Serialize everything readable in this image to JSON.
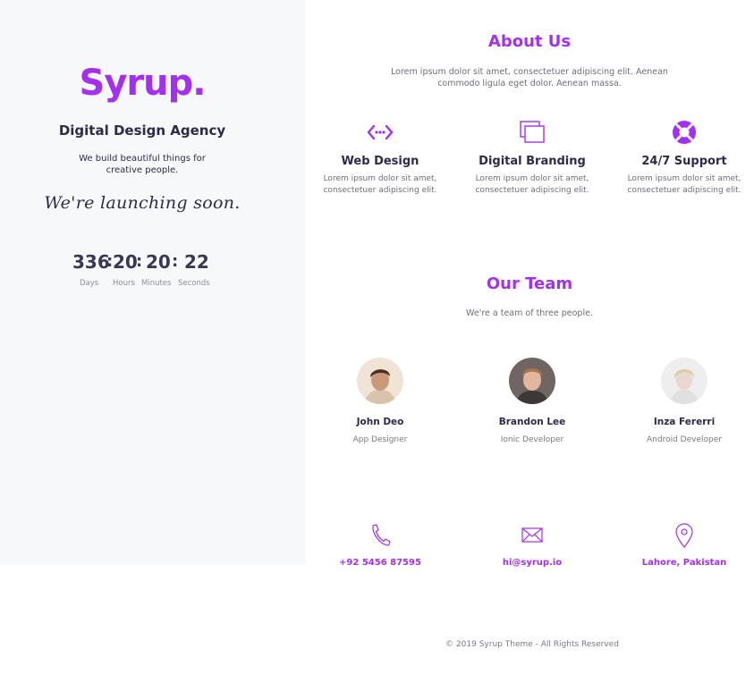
{
  "brand": {
    "logo": "Syrup.",
    "agency": "Digital Design Agency",
    "tagline_line1": "We build beautiful things for",
    "tagline_line2": "creative people.",
    "launching": "We're launching soon."
  },
  "countdown": {
    "days": "336",
    "hours": "20",
    "minutes": "20",
    "seconds": "22",
    "sep": ":",
    "labels": {
      "days": "Days",
      "hours": "Hours",
      "minutes": "Minutes",
      "seconds": "Seconds"
    }
  },
  "about": {
    "title": "About Us",
    "text": "Lorem ipsum dolor sit amet, consectetuer adipiscing elit. Aenean commodo ligula eget dolor. Aenean massa."
  },
  "services": [
    {
      "title": "Web Design",
      "line1": "Lorem ipsum dolor sit amet,",
      "line2": "consectetuer adipiscing elit.",
      "icon": "code-arrows-icon"
    },
    {
      "title": "Digital Branding",
      "line1": "Lorem ipsum dolor sit amet,",
      "line2": "consectetuer adipiscing elit.",
      "icon": "layers-icon"
    },
    {
      "title": "24/7 Support",
      "line1": "Lorem ipsum dolor sit amet,",
      "line2": "consectetuer adipiscing elit.",
      "icon": "lifebuoy-icon"
    }
  ],
  "team": {
    "title": "Our Team",
    "subtitle": "We're a team of three people.",
    "members": [
      {
        "name": "John Deo",
        "role": "App Designer"
      },
      {
        "name": "Brandon Lee",
        "role": "Ionic Developer"
      },
      {
        "name": "Inza Fererri",
        "role": "Android Developer"
      }
    ]
  },
  "contact": {
    "phone": "+92 5456 87595",
    "email": "hi@syrup.io",
    "location": "Lahore, Pakistan"
  },
  "footer": {
    "copyright": "© 2019 Syrup Theme - All Rights Reserved"
  },
  "colors": {
    "accent": "#a52ff0",
    "heading": "#2d2a4a",
    "left_bg": "#f7f8fa"
  }
}
